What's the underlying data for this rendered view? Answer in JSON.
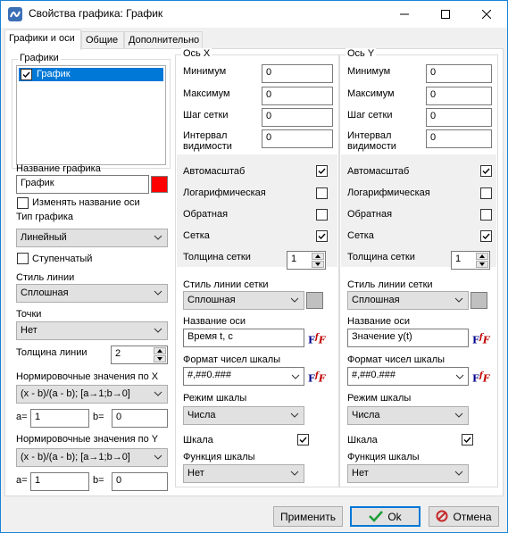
{
  "window": {
    "title": "Свойства графика: График"
  },
  "tabs": [
    {
      "label": "Графики и оси"
    },
    {
      "label": "Общие"
    },
    {
      "label": "Дополнительно"
    }
  ],
  "charts_panel": {
    "group_title": "Графики",
    "list_items": [
      {
        "label": "График",
        "checked": true
      }
    ],
    "chart_name_label": "Название графика",
    "chart_name_value": "График",
    "chart_color": "#ff0000",
    "rename_axis_label": "Изменять название оси",
    "chart_type_label": "Тип графика",
    "chart_type_value": "Линейный",
    "stepped_label": "Ступенчатый",
    "line_style_label": "Стиль линии",
    "line_style_value": "Сплошная",
    "points_label": "Точки",
    "points_value": "Нет",
    "line_width_label": "Толщина линии",
    "line_width_value": "2",
    "norm_x_label": "Нормировочные значения по X",
    "norm_x_formula": "(x - b)/(a - b);  [a→1;b→0]",
    "norm_x_a_label": "a=",
    "norm_x_a_value": "1",
    "norm_x_b_label": "b=",
    "norm_x_b_value": "0",
    "norm_y_label": "Нормировочные значения по Y",
    "norm_y_formula": "(x - b)/(a - b);  [a→1;b→0]",
    "norm_y_a_label": "a=",
    "norm_y_a_value": "1",
    "norm_y_b_label": "b=",
    "norm_y_b_value": "0"
  },
  "axis_x": {
    "group_title": "Ось X",
    "min_label": "Минимум",
    "min_value": "0",
    "max_label": "Максимум",
    "max_value": "0",
    "grid_step_label": "Шаг сетки",
    "grid_step_value": "0",
    "visible_interval_label_1": "Интервал",
    "visible_interval_label_2": "видимости",
    "visible_interval_value": "0",
    "autoscale_label": "Автомасштаб",
    "autoscale_checked": true,
    "log_label": "Логарифмическая",
    "log_checked": false,
    "inverse_label": "Обратная",
    "inverse_checked": false,
    "grid_label": "Сетка",
    "grid_checked": true,
    "grid_width_label": "Толщина  сетки",
    "grid_width_value": "1",
    "grid_line_style_label": "Стиль линии сетки",
    "grid_line_style_value": "Сплошная",
    "grid_color": "#c0c0c0",
    "axis_name_label": "Название оси",
    "axis_name_value": "Время t, с",
    "number_format_label": "Формат чисел шкалы",
    "number_format_value": "#,##0.###",
    "scale_mode_label": "Режим шкалы",
    "scale_mode_value": "Числа",
    "scale_label": "Шкала",
    "scale_checked": true,
    "scale_function_label": "Функция шкалы",
    "scale_function_value": "Нет"
  },
  "axis_y": {
    "group_title": "Ось Y",
    "min_label": "Минимум",
    "min_value": "0",
    "max_label": "Максимум",
    "max_value": "0",
    "grid_step_label": "Шаг сетки",
    "grid_step_value": "0",
    "visible_interval_label_1": "Интервал",
    "visible_interval_label_2": "видимости",
    "visible_interval_value": "0",
    "autoscale_label": "Автомасштаб",
    "autoscale_checked": true,
    "log_label": "Логарифмическая",
    "log_checked": false,
    "inverse_label": "Обратная",
    "inverse_checked": false,
    "grid_label": "Сетка",
    "grid_checked": true,
    "grid_width_label": "Толщина  сетки",
    "grid_width_value": "1",
    "grid_line_style_label": "Стиль линии сетки",
    "grid_line_style_value": "Сплошная",
    "grid_color": "#c0c0c0",
    "axis_name_label": "Название оси",
    "axis_name_value": "Значение y(t)",
    "number_format_label": "Формат чисел шкалы",
    "number_format_value": "#,##0.###",
    "scale_mode_label": "Режим шкалы",
    "scale_mode_value": "Числа",
    "scale_label": "Шкала",
    "scale_checked": true,
    "scale_function_label": "Функция шкалы",
    "scale_function_value": "Нет"
  },
  "format_icon": {
    "f": "F",
    "superscript": "f",
    "sub": "F"
  },
  "buttons": {
    "apply": "Применить",
    "ok": "Ok",
    "cancel": "Отмена"
  },
  "colors": {
    "accent": "#0078d7",
    "ok_icon": "#1e9e3a",
    "cancel_icon": "#c62828"
  }
}
